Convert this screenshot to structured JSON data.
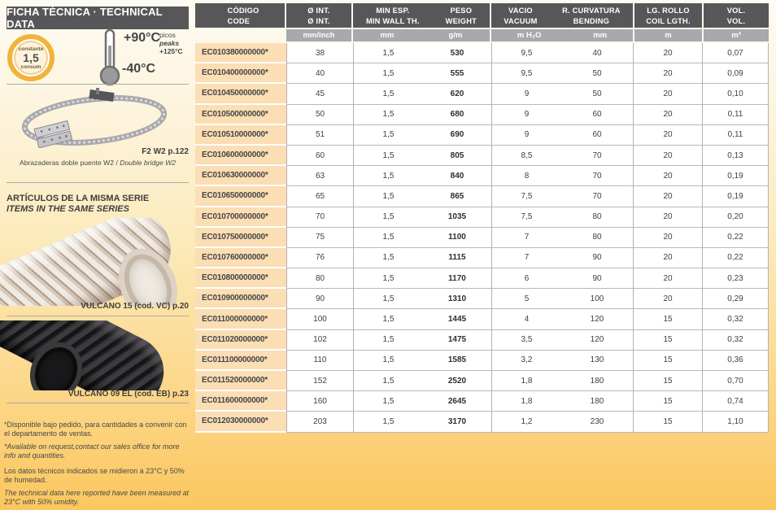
{
  "sidebar": {
    "title": "FICHA TÈCNICA · TECHNICAL DATA",
    "badge": {
      "top": "constante",
      "value": "1,5",
      "bottom": "consum"
    },
    "thermometer": {
      "max": "+90°C",
      "min": "-40°C",
      "peaks_es": "picos",
      "peaks_en": "peaks",
      "peak_value": "+125°C"
    },
    "clamp": {
      "ref": "F2 W2 p.122",
      "caption_es": "Abrazaderas doble puente W2 / ",
      "caption_en": "Double bridge W2"
    },
    "same_series": {
      "title_es": "ARTÍCULOS DE LA MISMA SERIE",
      "title_en": "ITEMS IN THE SAME SERIES",
      "product1_caption": "VULCANO 15 (cod. VC) p.20",
      "product2_caption": "VULCANO 09 EL (cod. EB) p.23"
    },
    "footnotes": {
      "es1": "*Disponible bajo pedido, para cantidades a convenir con el departamento de ventas.",
      "en1": "*Available on request,contact our sales office for more info and quantities.",
      "es2": "Los datos técnicos indicados se midieron a 23°C y 50% de humedad.",
      "en2": "The technical data here reported have been measured at 23°C with 50% umidity."
    }
  },
  "table": {
    "columns": [
      {
        "id": "code",
        "es": "CÓDIGO",
        "en": "CODE",
        "unit": ""
      },
      {
        "id": "diameter",
        "es": "Ø INT.",
        "en": "Ø INT.",
        "unit": "mm/inch"
      },
      {
        "id": "wall",
        "es": "MIN ESP.",
        "en": "MIN WALL TH.",
        "unit": "mm"
      },
      {
        "id": "weight",
        "es": "PESO",
        "en": "WEIGHT",
        "unit": "g/m"
      },
      {
        "id": "vacuum",
        "es": "VACIO",
        "en": "VACUUM",
        "unit": "m H₂O"
      },
      {
        "id": "bending",
        "es": "R. CURVATURA",
        "en": "BENDING",
        "unit": "mm"
      },
      {
        "id": "coil",
        "es": "LG. ROLLO",
        "en": "COIL LGTH.",
        "unit": "m"
      },
      {
        "id": "volume",
        "es": "VOL.",
        "en": "VOL.",
        "unit": "m³"
      }
    ],
    "rows": [
      {
        "code": "EC010380000000*",
        "diameter": "38",
        "wall": "1,5",
        "weight": "530",
        "vacuum": "9,5",
        "bending": "40",
        "coil": "20",
        "volume": "0,07"
      },
      {
        "code": "EC010400000000*",
        "diameter": "40",
        "wall": "1,5",
        "weight": "555",
        "vacuum": "9,5",
        "bending": "50",
        "coil": "20",
        "volume": "0,09"
      },
      {
        "code": "EC010450000000*",
        "diameter": "45",
        "wall": "1,5",
        "weight": "620",
        "vacuum": "9",
        "bending": "50",
        "coil": "20",
        "volume": "0,10"
      },
      {
        "code": "EC010500000000*",
        "diameter": "50",
        "wall": "1,5",
        "weight": "680",
        "vacuum": "9",
        "bending": "60",
        "coil": "20",
        "volume": "0,11"
      },
      {
        "code": "EC010510000000*",
        "diameter": "51",
        "wall": "1,5",
        "weight": "690",
        "vacuum": "9",
        "bending": "60",
        "coil": "20",
        "volume": "0,11"
      },
      {
        "code": "EC010600000000*",
        "diameter": "60",
        "wall": "1,5",
        "weight": "805",
        "vacuum": "8,5",
        "bending": "70",
        "coil": "20",
        "volume": "0,13"
      },
      {
        "code": "EC010630000000*",
        "diameter": "63",
        "wall": "1,5",
        "weight": "840",
        "vacuum": "8",
        "bending": "70",
        "coil": "20",
        "volume": "0,19"
      },
      {
        "code": "EC010650000000*",
        "diameter": "65",
        "wall": "1,5",
        "weight": "865",
        "vacuum": "7,5",
        "bending": "70",
        "coil": "20",
        "volume": "0,19"
      },
      {
        "code": "EC010700000000*",
        "diameter": "70",
        "wall": "1,5",
        "weight": "1035",
        "vacuum": "7,5",
        "bending": "80",
        "coil": "20",
        "volume": "0,20"
      },
      {
        "code": "EC010750000000*",
        "diameter": "75",
        "wall": "1,5",
        "weight": "1100",
        "vacuum": "7",
        "bending": "80",
        "coil": "20",
        "volume": "0,22"
      },
      {
        "code": "EC010760000000*",
        "diameter": "76",
        "wall": "1,5",
        "weight": "1115",
        "vacuum": "7",
        "bending": "90",
        "coil": "20",
        "volume": "0,22"
      },
      {
        "code": "EC010800000000*",
        "diameter": "80",
        "wall": "1,5",
        "weight": "1170",
        "vacuum": "6",
        "bending": "90",
        "coil": "20",
        "volume": "0,23"
      },
      {
        "code": "EC010900000000*",
        "diameter": "90",
        "wall": "1,5",
        "weight": "1310",
        "vacuum": "5",
        "bending": "100",
        "coil": "20",
        "volume": "0,29"
      },
      {
        "code": "EC011000000000*",
        "diameter": "100",
        "wall": "1,5",
        "weight": "1445",
        "vacuum": "4",
        "bending": "120",
        "coil": "15",
        "volume": "0,32"
      },
      {
        "code": "EC011020000000*",
        "diameter": "102",
        "wall": "1,5",
        "weight": "1475",
        "vacuum": "3,5",
        "bending": "120",
        "coil": "15",
        "volume": "0,32"
      },
      {
        "code": "EC011100000000*",
        "diameter": "110",
        "wall": "1,5",
        "weight": "1585",
        "vacuum": "3,2",
        "bending": "130",
        "coil": "15",
        "volume": "0,36"
      },
      {
        "code": "EC011520000000*",
        "diameter": "152",
        "wall": "1,5",
        "weight": "2520",
        "vacuum": "1,8",
        "bending": "180",
        "coil": "15",
        "volume": "0,70"
      },
      {
        "code": "EC011600000000*",
        "diameter": "160",
        "wall": "1,5",
        "weight": "2645",
        "vacuum": "1,8",
        "bending": "180",
        "coil": "15",
        "volume": "0,74"
      },
      {
        "code": "EC012030000000*",
        "diameter": "203",
        "wall": "1,5",
        "weight": "3170",
        "vacuum": "1,2",
        "bending": "230",
        "coil": "15",
        "volume": "1,10"
      }
    ]
  },
  "colors": {
    "header_bg": "#57575a",
    "units_bg": "#a7a9ac",
    "code_cell_bg": "#fbdeb4",
    "page_orange": "#fbc75e",
    "badge_ring": "#f0b43c"
  }
}
